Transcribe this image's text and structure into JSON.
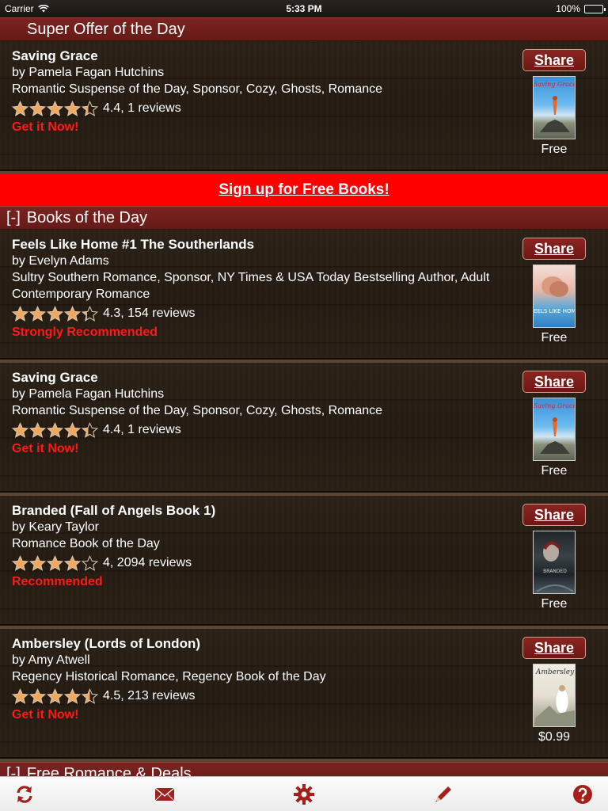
{
  "status_bar": {
    "carrier": "Carrier",
    "time": "5:33 PM",
    "battery": "100%"
  },
  "super_offer": {
    "header": "Super Offer of the Day",
    "book": {
      "title": "Saving Grace",
      "author": "by Pamela Fagan Hutchins",
      "genres": "Romantic Suspense of the Day, Sponsor, Cozy, Ghosts, Romance",
      "rating": 4.4,
      "rating_text": "4.4, 1 reviews",
      "cta": "Get it Now!",
      "share": "Share",
      "price": "Free"
    }
  },
  "signup": {
    "label": "Sign up for Free Books!"
  },
  "books_of_day": {
    "toggle": "[-]",
    "header": "Books of the Day",
    "books": [
      {
        "title": "Feels Like Home #1 The Southerlands",
        "author": "by Evelyn Adams",
        "genres": "Sultry Southern Romance, Sponsor, NY Times & USA Today Bestselling Author, Adult Contemporary Romance",
        "rating": 4.3,
        "rating_text": "4.3, 154 reviews",
        "cta": "Strongly Recommended",
        "share": "Share",
        "price": "Free"
      },
      {
        "title": "Saving Grace",
        "author": "by Pamela Fagan Hutchins",
        "genres": "Romantic Suspense of the Day, Sponsor, Cozy, Ghosts, Romance",
        "rating": 4.4,
        "rating_text": "4.4, 1 reviews",
        "cta": "Get it Now!",
        "share": "Share",
        "price": "Free"
      },
      {
        "title": "Branded (Fall of Angels Book 1)",
        "author": "by Keary Taylor",
        "genres": "Romance Book of the Day",
        "rating": 4,
        "rating_text": "4, 2094 reviews",
        "cta": "Recommended",
        "share": "Share",
        "price": "Free"
      },
      {
        "title": "Ambersley (Lords of London)",
        "author": "by Amy Atwell",
        "genres": "Regency Historical Romance, Regency Book of the Day",
        "rating": 4.5,
        "rating_text": "4.5, 213 reviews",
        "cta": "Get it Now!",
        "share": "Share",
        "price": "$0.99"
      }
    ]
  },
  "free_romance": {
    "toggle": "[-]",
    "header": "Free Romance & Deals"
  },
  "toolbar": {
    "icons": [
      "refresh-icon",
      "mail-icon",
      "gear-icon",
      "pencil-icon",
      "help-icon"
    ],
    "accent": "#a3201c"
  },
  "colors": {
    "header_bg": "#701e1a",
    "signup_bg": "#ff0000",
    "cta": "#ff1a1a",
    "star": "#f0a860"
  },
  "covers": {
    "saving_grace_text": "Saving Grace",
    "feels_like_home_text": "FEELS LIKE HOME",
    "branded_text": "BRANDED",
    "ambersley_text": "Ambersley"
  }
}
